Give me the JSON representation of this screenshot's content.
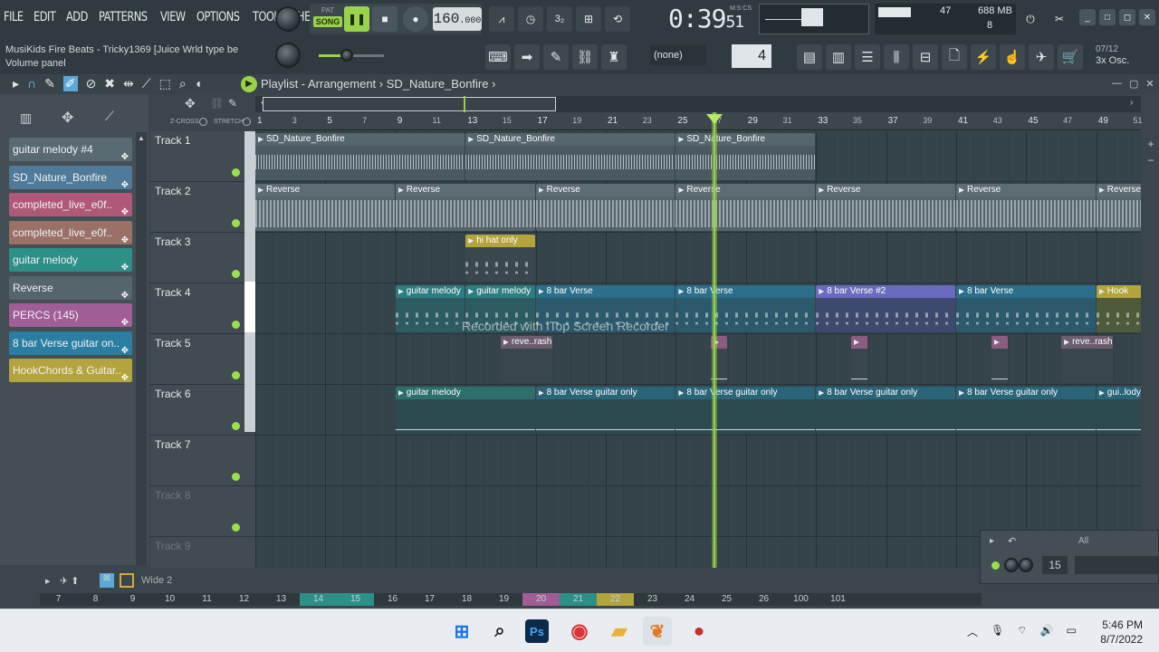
{
  "menu": [
    "FILE",
    "EDIT",
    "ADD",
    "PATTERNS",
    "VIEW",
    "OPTIONS",
    "TOOLS",
    "HELP"
  ],
  "transport": {
    "pat": "PAT",
    "song": "SONG",
    "tempo_main": "160",
    "tempo_dec": ".000",
    "time_main": "0:39",
    "time_sub": "51",
    "time_label": "M:S:CS"
  },
  "monitor": {
    "cpu": "47",
    "memory": "688 MB",
    "polyphony": "8"
  },
  "hint": {
    "line1": "MusiKids Fire Beats - Tricky1369 [Juice Wrld type be",
    "line2": "Volume panel"
  },
  "snap": {
    "value": "(none)",
    "step": "4"
  },
  "recent": {
    "date": "07/12",
    "label": "3x Osc."
  },
  "breadcrumb": {
    "title": "Playlist - Arrangement",
    "separator": "›",
    "pattern": "SD_Nature_Bonfire"
  },
  "ruler": {
    "zcross": "Z-CROSS",
    "stretch": "STRETCH",
    "ticks": [
      "1",
      "3",
      "5",
      "7",
      "9",
      "11",
      "13",
      "15",
      "17",
      "19",
      "21",
      "23",
      "25",
      "27",
      "29",
      "31",
      "33",
      "35",
      "37",
      "39",
      "41",
      "43",
      "45",
      "47",
      "49",
      "51"
    ]
  },
  "picker": [
    "guitar melody #4",
    "SD_Nature_Bonfire",
    "completed_live_e0f..",
    "completed_live_e0f..",
    "guitar melody",
    "Reverse",
    "PERCS (145)",
    "8 bar Verse guitar on..",
    "HookChords & Guitar.."
  ],
  "picker_colors": [
    "#5a6a72",
    "#4f7a9a",
    "#b0587a",
    "#9a7067",
    "#2c8f88",
    "#56646c",
    "#a05d96",
    "#2b7da1",
    "#b3a43e"
  ],
  "tracks": [
    "Track 1",
    "Track 2",
    "Track 3",
    "Track 4",
    "Track 5",
    "Track 6",
    "Track 7",
    "Track 8",
    "Track 9"
  ],
  "clips": {
    "t1": [
      "SD_Nature_Bonfire",
      "SD_Nature_Bonfire",
      "SD_Nature_Bonfire"
    ],
    "t2": [
      "Reverse",
      "Reverse",
      "Reverse",
      "Reverse",
      "Reverse",
      "Reverse",
      "Reverse"
    ],
    "t3": [
      "hi hat only"
    ],
    "t4": [
      "guitar melody",
      "guitar melody",
      "8 bar Verse",
      "8 bar Verse",
      "8 bar Verse #2",
      "8 bar Verse",
      "Hook"
    ],
    "t5": [
      "reve..rash",
      "",
      "",
      "",
      "reve..rash"
    ],
    "t6": [
      "guitar melody",
      "8 bar Verse guitar only",
      "8 bar Verse guitar only",
      "8 bar Verse guitar only",
      "8 bar Verse guitar only",
      "gui..lody"
    ]
  },
  "watermark": "Recorded with iTop Screen Recorder",
  "bottom": {
    "wide": "Wide 2",
    "mixer_all": "All",
    "mixer_value": "15",
    "mixer_nums": [
      "7",
      "8",
      "9",
      "10",
      "11",
      "12",
      "13",
      "14",
      "15",
      "16",
      "17",
      "18",
      "19",
      "20",
      "21",
      "22",
      "23",
      "24",
      "25",
      "26",
      "100",
      "101"
    ]
  },
  "taskbar": {
    "time": "5:46 PM",
    "date": "8/7/2022"
  }
}
